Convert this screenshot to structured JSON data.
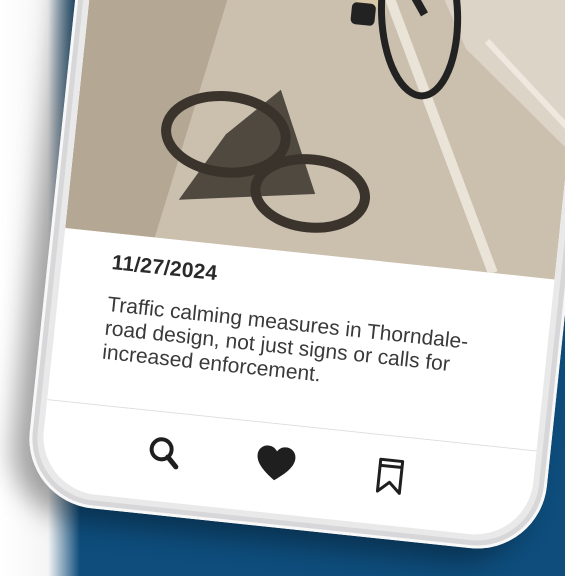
{
  "post": {
    "date": "11/27/2024",
    "text": "Traffic calming measures in Thorndale- road design, not just signs or calls for increased enforcement."
  },
  "photo": {
    "icon": "cyclist-photo"
  },
  "nav": {
    "items": [
      {
        "icon": "search-icon"
      },
      {
        "icon": "heart-icon"
      },
      {
        "icon": "bookmark-icon"
      }
    ]
  },
  "colors": {
    "background_blue": "#0e4d7c",
    "text_dark": "#2a2a2a",
    "icon_dark": "#1f1f1f"
  }
}
